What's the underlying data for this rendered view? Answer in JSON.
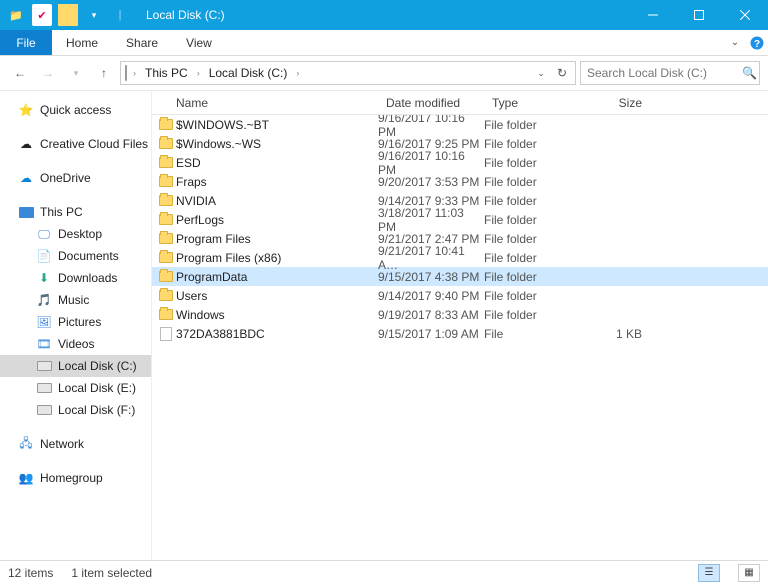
{
  "title": "Local Disk (C:)",
  "ribbon": {
    "file": "File",
    "tabs": [
      "Home",
      "Share",
      "View"
    ]
  },
  "nav_arrows": {
    "back": "←",
    "fwd": "→",
    "up": "↑"
  },
  "breadcrumbs": [
    "This PC",
    "Local Disk (C:)"
  ],
  "search": {
    "placeholder": "Search Local Disk (C:)"
  },
  "navpane": {
    "quick_access": "Quick access",
    "creative_cloud": "Creative Cloud Files",
    "onedrive": "OneDrive",
    "this_pc": "This PC",
    "desktop": "Desktop",
    "documents": "Documents",
    "downloads": "Downloads",
    "music": "Music",
    "pictures": "Pictures",
    "videos": "Videos",
    "drive_c": "Local Disk (C:)",
    "drive_e": "Local Disk (E:)",
    "drive_f": "Local Disk (F:)",
    "network": "Network",
    "homegroup": "Homegroup"
  },
  "columns": {
    "name": "Name",
    "date": "Date modified",
    "type": "Type",
    "size": "Size"
  },
  "files": [
    {
      "icon": "folder",
      "name": "$WINDOWS.~BT",
      "date": "9/16/2017 10:16 PM",
      "type": "File folder",
      "size": ""
    },
    {
      "icon": "folder",
      "name": "$Windows.~WS",
      "date": "9/16/2017 9:25 PM",
      "type": "File folder",
      "size": ""
    },
    {
      "icon": "folder",
      "name": "ESD",
      "date": "9/16/2017 10:16 PM",
      "type": "File folder",
      "size": ""
    },
    {
      "icon": "folder",
      "name": "Fraps",
      "date": "9/20/2017 3:53 PM",
      "type": "File folder",
      "size": ""
    },
    {
      "icon": "folder",
      "name": "NVIDIA",
      "date": "9/14/2017 9:33 PM",
      "type": "File folder",
      "size": ""
    },
    {
      "icon": "folder",
      "name": "PerfLogs",
      "date": "3/18/2017 11:03 PM",
      "type": "File folder",
      "size": ""
    },
    {
      "icon": "folder",
      "name": "Program Files",
      "date": "9/21/2017 2:47 PM",
      "type": "File folder",
      "size": ""
    },
    {
      "icon": "folder",
      "name": "Program Files (x86)",
      "date": "9/21/2017 10:41 A…",
      "type": "File folder",
      "size": ""
    },
    {
      "icon": "folder",
      "name": "ProgramData",
      "date": "9/15/2017 4:38 PM",
      "type": "File folder",
      "size": "",
      "selected": true
    },
    {
      "icon": "folder",
      "name": "Users",
      "date": "9/14/2017 9:40 PM",
      "type": "File folder",
      "size": ""
    },
    {
      "icon": "folder",
      "name": "Windows",
      "date": "9/19/2017 8:33 AM",
      "type": "File folder",
      "size": ""
    },
    {
      "icon": "file",
      "name": "372DA3881BDC",
      "date": "9/15/2017 1:09 AM",
      "type": "File",
      "size": "1 KB"
    }
  ],
  "status": {
    "count": "12 items",
    "selected": "1 item selected"
  }
}
